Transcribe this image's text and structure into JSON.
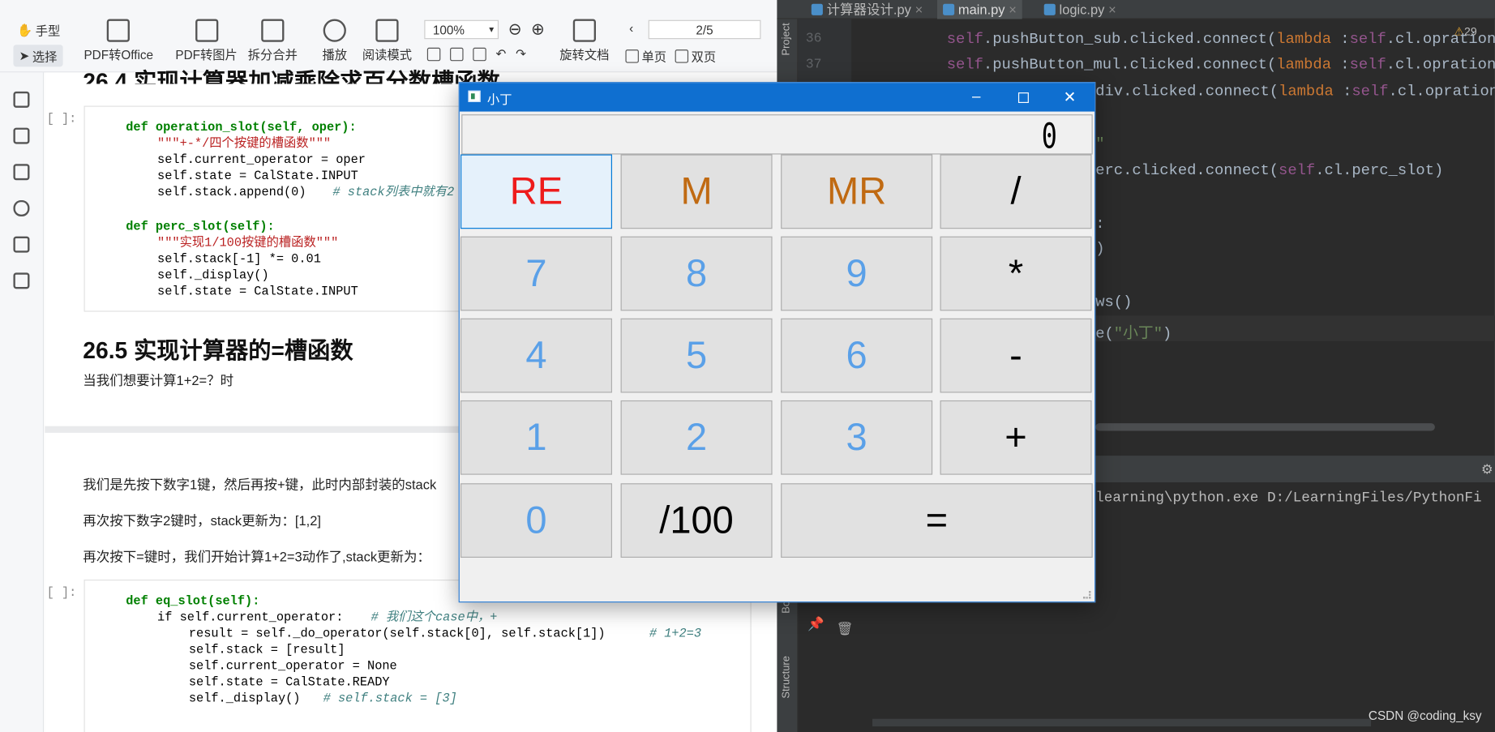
{
  "pdf": {
    "toolbar": {
      "hand": "手型",
      "select": "选择",
      "pdf_to_office": "PDF转Office",
      "pdf_to_image": "PDF转图片",
      "split_merge": "拆分合并",
      "play": "播放",
      "read_mode": "阅读模式",
      "zoom": "100%",
      "rotate": "旋转文档",
      "page": "2/5",
      "single": "单页",
      "double": "双页"
    },
    "heading_top": "26.4 实现计算器加减乘除求百分数槽函数",
    "prompt": "[ ]:",
    "code1": [
      "def operation_slot(self, oper):",
      "\"\"\"+-*/四个按键的槽函数\"\"\"",
      "self.current_operator = oper",
      "self.state = CalState.INPUT",
      "self.stack.append(0)",
      "# stack列表中就有2",
      "def perc_slot(self):",
      "\"\"\"实现1/100按键的槽函数\"\"\"",
      "self.stack[-1] *= 0.01",
      "self._display()",
      "self.state = CalState.INPUT"
    ],
    "heading2": "26.5 实现计算器的=槽函数",
    "para1": "当我们想要计算1+2=？时",
    "para2": "我们是先按下数字1键，然后再按+键，此时内部封装的stack",
    "para3": "再次按下数字2键时，stack更新为：[1,2]",
    "para4": "再次按下=键时，我们开始计算1+2=3动作了,stack更新为：",
    "code2": [
      "def eq_slot(self):",
      "if self.current_operator:",
      "# 我们这个case中，+",
      "result = self._do_operator(self.stack[0], self.stack[1])",
      "# 1+2=3",
      "self.stack = [result]",
      "self.current_operator = None",
      "self.state = CalState.READY",
      "self._display()",
      "# self.stack = [3]"
    ]
  },
  "ide": {
    "tabs": [
      "计算器设计.py",
      "main.py",
      "logic.py"
    ],
    "line_numbers": [
      "36",
      "37"
    ],
    "warning_count": "29",
    "code_lines": [
      "self.pushButton_sub.clicked.connect(lambda :self.cl.opration_s",
      "self.pushButton_mul.clicked.connect(lambda :self.cl.opration_s",
      "div.clicked.connect(lambda :self.cl.opration_s",
      "\"",
      "erc.clicked.connect(self.cl.perc_slot)",
      ":",
      ")",
      "ws()",
      "e(\"小丁\")"
    ],
    "console_line": "learning\\python.exe D:/LearningFiles/PythonFi",
    "side_labels": [
      "Project",
      "Structure",
      "Bo"
    ],
    "watermark": "CSDN @coding_ksy"
  },
  "calculator": {
    "title": "小丁",
    "display": "0",
    "buttons": [
      {
        "label": "RE",
        "kind": "re"
      },
      {
        "label": "M",
        "kind": "mem"
      },
      {
        "label": "MR",
        "kind": "mem"
      },
      {
        "label": "/",
        "kind": "op"
      },
      {
        "label": "7",
        "kind": "digit"
      },
      {
        "label": "8",
        "kind": "digit"
      },
      {
        "label": "9",
        "kind": "digit"
      },
      {
        "label": "*",
        "kind": "op"
      },
      {
        "label": "4",
        "kind": "digit"
      },
      {
        "label": "5",
        "kind": "digit"
      },
      {
        "label": "6",
        "kind": "digit"
      },
      {
        "label": "-",
        "kind": "op"
      },
      {
        "label": "1",
        "kind": "digit"
      },
      {
        "label": "2",
        "kind": "digit"
      },
      {
        "label": "3",
        "kind": "digit"
      },
      {
        "label": "+",
        "kind": "op"
      },
      {
        "label": "0",
        "kind": "digit"
      },
      {
        "label": "/100",
        "kind": "op"
      },
      {
        "label": "=",
        "kind": "op"
      }
    ]
  },
  "colors": {
    "title_bar": "#0f6fd0",
    "digit": "#5aa0e8",
    "memory": "#c06a12",
    "reset": "#ee1c1c"
  }
}
